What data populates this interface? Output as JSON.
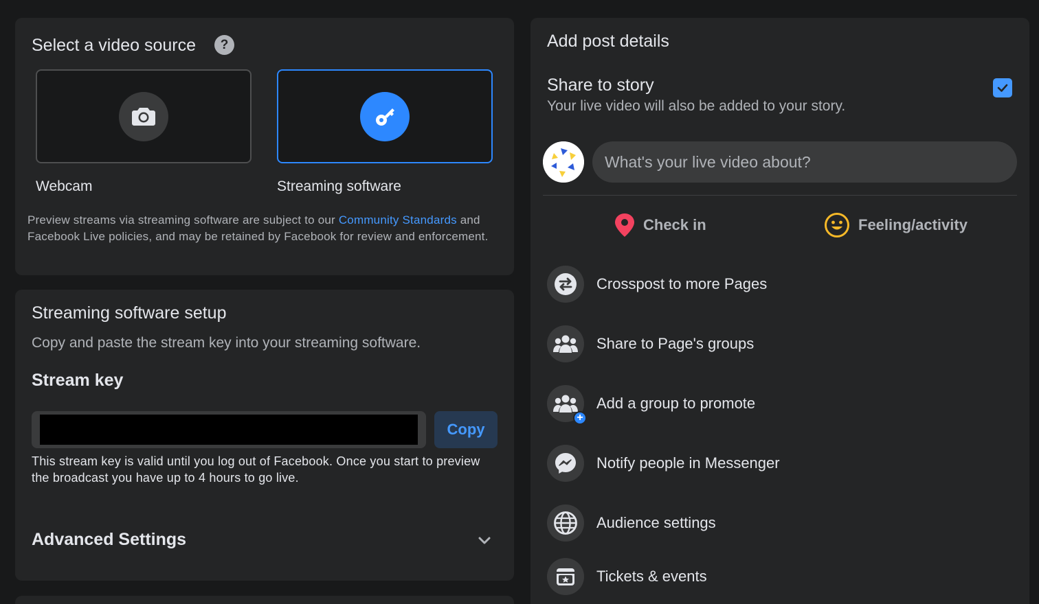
{
  "video_source": {
    "title": "Select a video source",
    "help_icon": "?",
    "options": [
      {
        "label": "Webcam",
        "icon": "camera-icon",
        "selected": false
      },
      {
        "label": "Streaming software",
        "icon": "key-icon",
        "selected": true
      }
    ],
    "legal_prefix": "Preview streams via streaming software are subject to our ",
    "legal_link": "Community Standards",
    "legal_suffix": " and Facebook Live policies, and may be retained by Facebook for review and enforcement."
  },
  "setup": {
    "title": "Streaming software setup",
    "description": "Copy and paste the stream key into your streaming software.",
    "stream_key_label": "Stream key",
    "copy_label": "Copy",
    "validity_note": "This stream key is valid until you log out of Facebook. Once you start to preview the broadcast you have up to 4 hours to go live.",
    "advanced_label": "Advanced Settings"
  },
  "post_details": {
    "title": "Add post details",
    "share_story_title": "Share to story",
    "share_story_sub": "Your live video will also be added to your story.",
    "share_story_checked": true,
    "composer_placeholder": "What's your live video about?",
    "actions": [
      {
        "label": "Check in",
        "icon": "location-pin-icon",
        "color": "#f3425f"
      },
      {
        "label": "Feeling/activity",
        "icon": "smiley-icon",
        "color": "#f7b928"
      }
    ],
    "rows": [
      {
        "label": "Crosspost to more Pages",
        "icon": "crosspost-icon"
      },
      {
        "label": "Share to Page's groups",
        "icon": "groups-icon"
      },
      {
        "label": "Add a group to promote",
        "icon": "add-group-icon"
      },
      {
        "label": "Notify people in Messenger",
        "icon": "messenger-icon"
      },
      {
        "label": "Audience settings",
        "icon": "globe-icon"
      },
      {
        "label": "Tickets & events",
        "icon": "ticket-calendar-icon"
      }
    ]
  },
  "colors": {
    "background": "#18191a",
    "card": "#242526",
    "accent": "#2d88ff",
    "link": "#4599ff"
  }
}
